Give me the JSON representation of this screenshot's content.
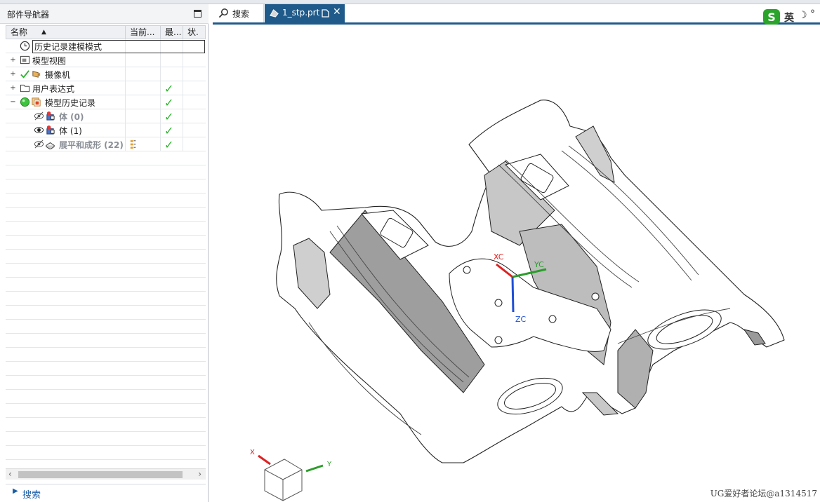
{
  "navigator": {
    "title": "部件导航器",
    "columns": {
      "name": "名称",
      "current": "当前...",
      "latest": "最...",
      "status": "状."
    },
    "rows": [
      {
        "label": "历史记录建模模式",
        "expander": ""
      },
      {
        "label": "模型视图",
        "expander": "+"
      },
      {
        "label": "摄像机",
        "expander": "+"
      },
      {
        "label": "用户表达式",
        "expander": "+"
      },
      {
        "label": "模型历史记录",
        "expander": "−"
      },
      {
        "label": "体 (0)",
        "expander": ""
      },
      {
        "label": "体 (1)",
        "expander": ""
      },
      {
        "label": "展平和成形 (22)",
        "expander": ""
      }
    ],
    "search_label": "搜索"
  },
  "tabs": {
    "search": "搜索",
    "active": "1_stp.prt"
  },
  "viewport": {
    "axis_labels": {
      "xc": "XC",
      "yc": "YC",
      "zc": "ZC",
      "x": "X",
      "y": "Y"
    },
    "watermark": "UG爱好者论坛@a1314517"
  },
  "ime": {
    "label": "英"
  },
  "colors": {
    "accent": "#1f5a8a",
    "check": "#2fb52f",
    "x_axis": "#d22",
    "y_axis": "#2a9d2a",
    "z_axis": "#1f4fd6"
  }
}
